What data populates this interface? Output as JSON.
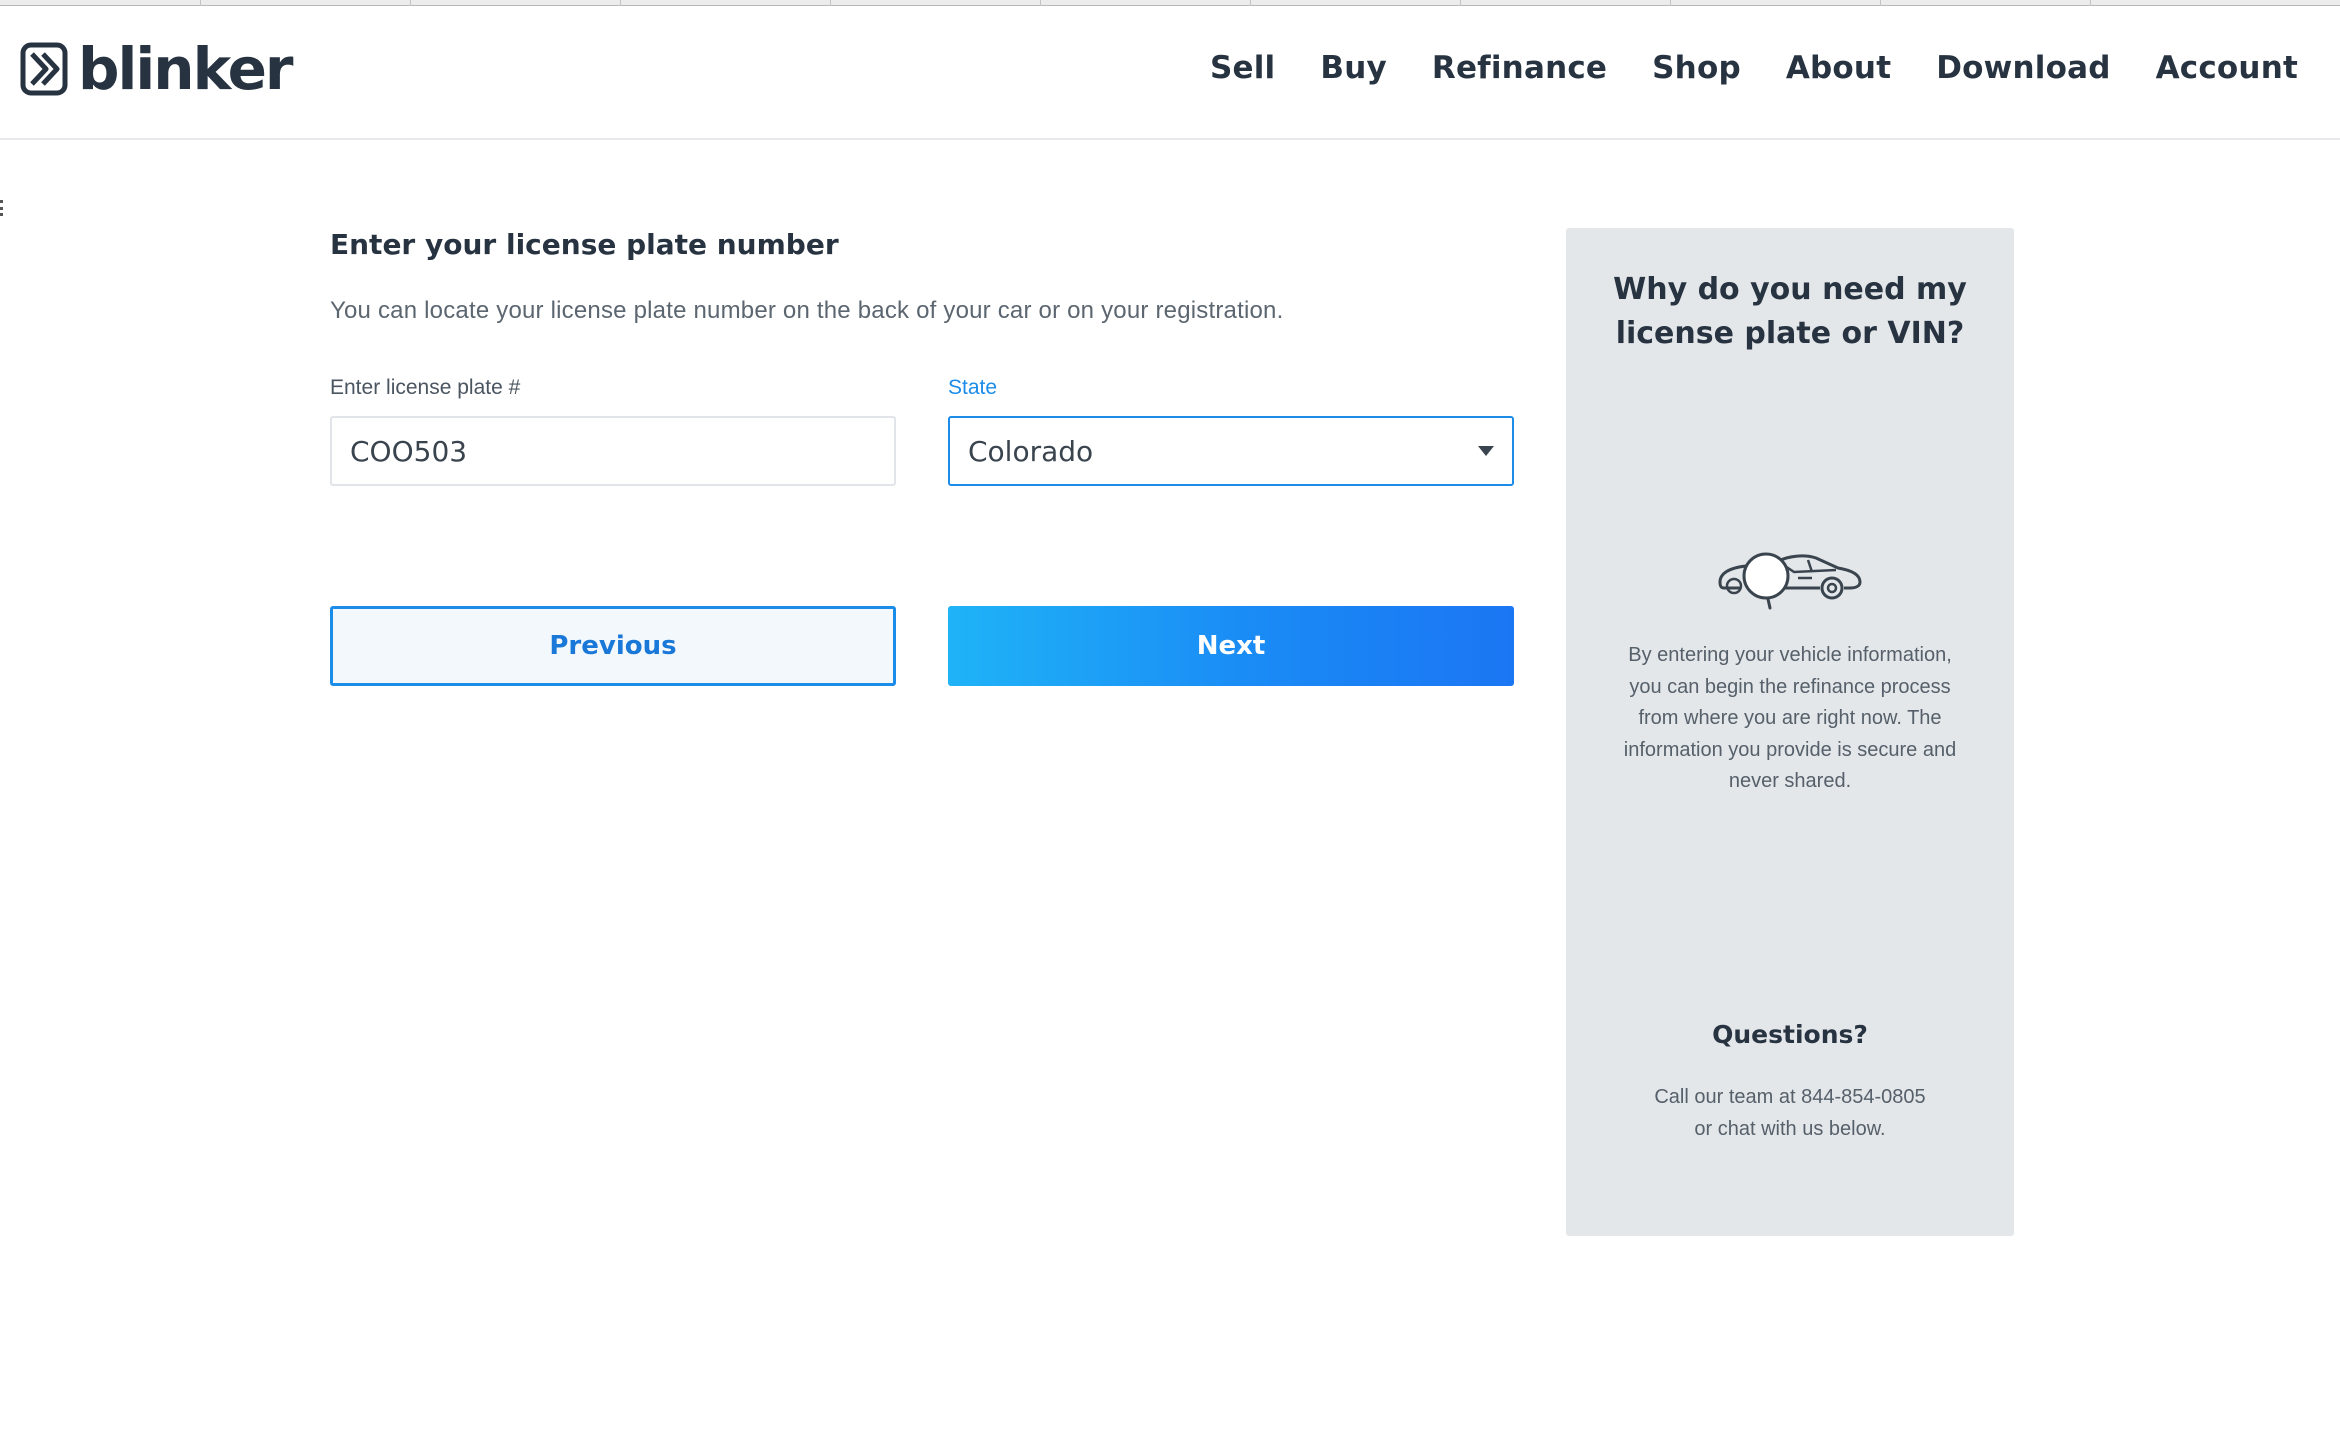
{
  "header": {
    "logo_text": "blinker",
    "nav": [
      "Sell",
      "Buy",
      "Refinance",
      "Shop",
      "About",
      "Download",
      "Account"
    ]
  },
  "form": {
    "title": "Enter your license plate number",
    "subtitle": "You can locate your license plate number on the back of your car or on your registration.",
    "plate_label": "Enter license plate #",
    "plate_value": "COO503",
    "state_label": "State",
    "state_value": "Colorado",
    "previous_label": "Previous",
    "next_label": "Next"
  },
  "side_panel": {
    "title_line1": "Why do you need my",
    "title_line2": "license plate or VIN?",
    "illustration_icon": "car-magnifier-icon",
    "body_line1": "By entering your vehicle information,",
    "body_line2": "you can begin the refinance process",
    "body_line3": "from where you are right now. The",
    "body_line4": "information you provide is secure and",
    "body_line5": "never shared.",
    "questions_title": "Questions?",
    "questions_line1": "Call our team at 844-854-0805",
    "questions_line2": "or chat with us below."
  },
  "colors": {
    "accent": "#1b8ce8",
    "text_dark": "#273340",
    "panel_bg": "#e4e7ea"
  }
}
